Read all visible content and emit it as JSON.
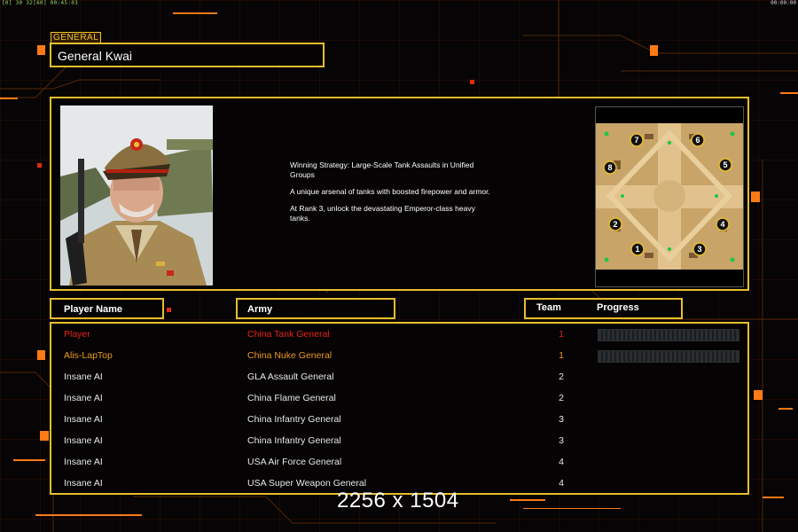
{
  "hud": {
    "left": "[0] 30 32[60] 00:45:03",
    "right": "00:00:00"
  },
  "general": {
    "section_label": "GENERAL",
    "name": "General Kwai",
    "portrait_icon": "general-portrait",
    "strategy": [
      "Winning Strategy: Large-Scale Tank Assaults in Unified\n Groups",
      "A unique arsenal of tanks with boosted firepower and armor.",
      "At Rank 3, unlock the devastating Emperor-class heavy\n tanks."
    ]
  },
  "minimap": {
    "slots": [
      "7",
      "6",
      "8",
      "5",
      "2",
      "4",
      "1",
      "3"
    ]
  },
  "columns": {
    "player": "Player Name",
    "army": "Army",
    "team": "Team",
    "progress": "Progress"
  },
  "players": [
    {
      "name": "Player",
      "army": "China Tank General",
      "team": "1",
      "color": "#e8231a",
      "progress": true
    },
    {
      "name": "Alis-LapTop",
      "army": "China Nuke General",
      "team": "1",
      "color": "#ef9a1e",
      "progress": true
    },
    {
      "name": "Insane AI",
      "army": "GLA Assault General",
      "team": "2",
      "color": "#e8e8e8",
      "progress": false
    },
    {
      "name": "Insane AI",
      "army": "China Flame General",
      "team": "2",
      "color": "#e8e8e8",
      "progress": false
    },
    {
      "name": "Insane AI",
      "army": "China Infantry General",
      "team": "3",
      "color": "#e8e8e8",
      "progress": false
    },
    {
      "name": "Insane AI",
      "army": "China Infantry General",
      "team": "3",
      "color": "#e8e8e8",
      "progress": false
    },
    {
      "name": "Insane AI",
      "army": "USA Air Force General",
      "team": "4",
      "color": "#e8e8e8",
      "progress": false
    },
    {
      "name": "Insane AI",
      "army": "USA Super Weapon General",
      "team": "4",
      "color": "#e8e8e8",
      "progress": false
    }
  ],
  "watermark": "2256 x 1504",
  "colors": {
    "frame": "#e8be2c",
    "accent": "#ff7a14",
    "player_red": "#e8231a",
    "ally_orange": "#ef9a1e"
  }
}
